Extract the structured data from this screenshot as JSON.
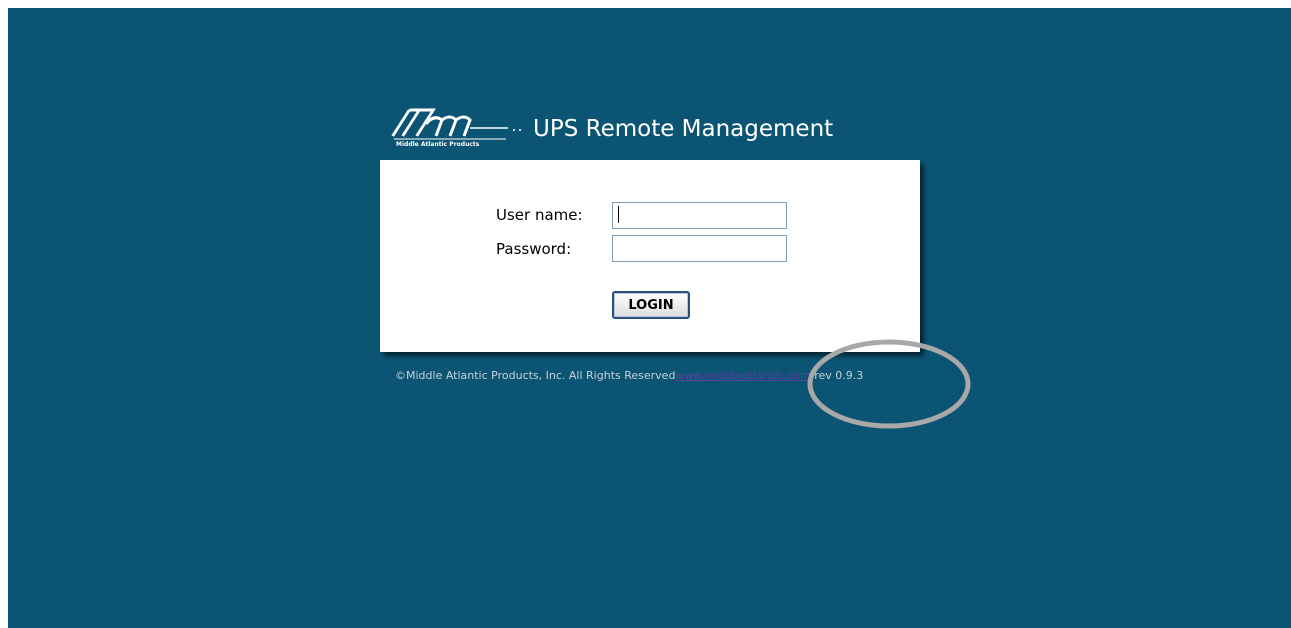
{
  "app": {
    "logo_caption": "Middle Atlantic Products",
    "title": "UPS Remote Management"
  },
  "login": {
    "username_label": "User name:",
    "username_value": "",
    "password_label": "Password:",
    "password_value": "",
    "login_button": "LOGIN"
  },
  "footer": {
    "copyright": "©Middle Atlantic Products, Inc. All Rights Reserved",
    "link_text": "www.middleatlantic.com",
    "revision": "rev 0.9.3"
  },
  "colors": {
    "page_background": "#0c5474",
    "panel_background": "#ffffff",
    "annotation_ellipse": "#a8a8a8"
  }
}
